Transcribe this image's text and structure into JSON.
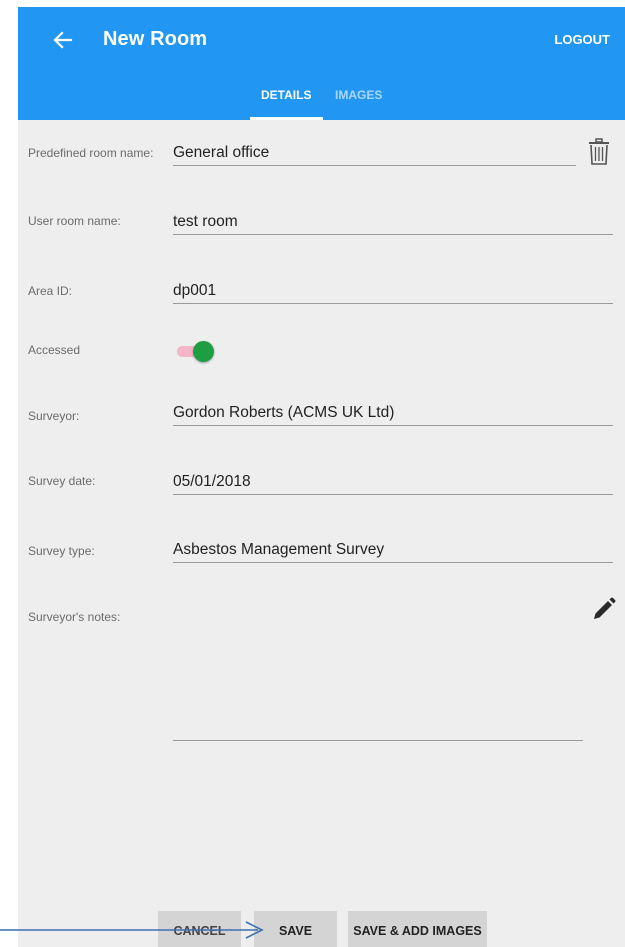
{
  "appbar": {
    "title": "New Room",
    "logout_label": "LOGOUT",
    "back_icon": "arrow-left-icon",
    "color": "#2196f3"
  },
  "tabs": [
    {
      "label": "DETAILS",
      "selected": true
    },
    {
      "label": "IMAGES",
      "selected": false
    }
  ],
  "form": {
    "predefined_room_name": {
      "label": "Predefined room name:",
      "value": "General office"
    },
    "user_room_name": {
      "label": "User room name:",
      "value": "test room"
    },
    "area_id": {
      "label": "Area ID:",
      "value": "dp001"
    },
    "accessed": {
      "label": "Accessed",
      "checked": true
    },
    "surveyor": {
      "label": "Surveyor:",
      "value": "Gordon Roberts (ACMS UK Ltd)"
    },
    "survey_date": {
      "label": "Survey date:",
      "value": "05/01/2018"
    },
    "survey_type": {
      "label": "Survey type:",
      "value": "Asbestos Management Survey"
    },
    "surveyors_notes": {
      "label": "Surveyor's notes:",
      "value": ""
    }
  },
  "icons": {
    "trash": "trash-icon",
    "pencil": "pencil-icon"
  },
  "buttons": {
    "cancel": "CANCEL",
    "save": "SAVE",
    "save_add_images": "SAVE & ADD IMAGES"
  },
  "colors": {
    "toggle_thumb": "#1e9e42",
    "toggle_track": "#f4b5c9",
    "annotation_arrow": "#3d6fb0"
  }
}
